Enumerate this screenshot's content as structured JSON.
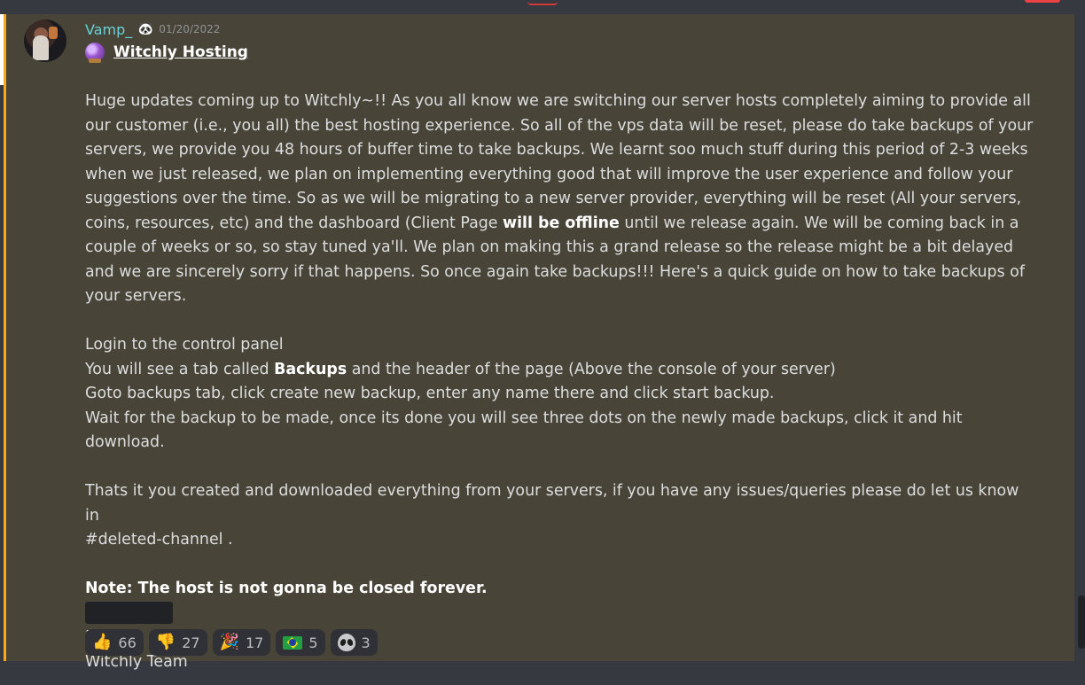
{
  "message": {
    "author": "Vamp_",
    "author_badge": "panda-emoji",
    "timestamp": "01/20/2022",
    "title": "Witchly Hosting",
    "title_icon": "crystal-ball-icon",
    "paragraph1": "Huge updates coming up to Witchly~!! As you all know we are switching our server hosts completely aiming to provide all our customer (i.e., you all) the best hosting experience. So all of the vps data will be reset, please do take backups of your servers, we provide you 48 hours of buffer time to take backups. We learnt soo much stuff during this period of 2-3 weeks when we just released, we plan on implementing everything good that will improve the user experience and follow your suggestions over the time. So as we will be migrating to a new server provider, everything will be reset (All your servers, coins, resources, etc) and the dashboard (Client Page ",
    "paragraph1_bold": "will be offline",
    "paragraph1_end": " until we release again. We will be coming back in a couple of weeks or so, so stay tuned ya'll. We plan on making this a grand release so the release might be a bit delayed and we are sincerely sorry if that happens. So once again take backups!!! Here's a quick guide on how to take backups of your servers.",
    "steps": {
      "step1": "Login to the control panel",
      "step2_pre": "You will see a tab called ",
      "step2_bold": "Backups",
      "step2_post": " and the header of the page (Above the console of your server)",
      "step3": "Goto backups tab, click create new backup, enter any name there and click start backup.",
      "step4": "Wait for the backup to be made, once its done you will see three dots on the newly made backups, click it and hit download."
    },
    "closing_line1": "Thats it you created and downloaded everything from your servers, if you have any issues/queries please do let us know in",
    "channel_mention": "#deleted-channel",
    "closing_line2_end": " .",
    "note": "Note: The host is not gonna be closed forever.",
    "signoff1": "Best,",
    "signoff2": "Witchly Team"
  },
  "reactions": [
    {
      "emoji": "👍",
      "name": "thumbs-up-icon",
      "count": "66"
    },
    {
      "emoji": "👎",
      "name": "thumbs-down-icon",
      "count": "27"
    },
    {
      "emoji": "🎉",
      "name": "party-popper-icon",
      "count": "17"
    },
    {
      "emoji": "",
      "name": "brazil-flag-icon",
      "count": "5"
    },
    {
      "emoji": "",
      "name": "alien-icon",
      "count": "3"
    }
  ],
  "colors": {
    "message_bg": "#494438",
    "highlight_border": "#faa81a",
    "username": "#66d1d6",
    "page_bg": "#36393f"
  }
}
